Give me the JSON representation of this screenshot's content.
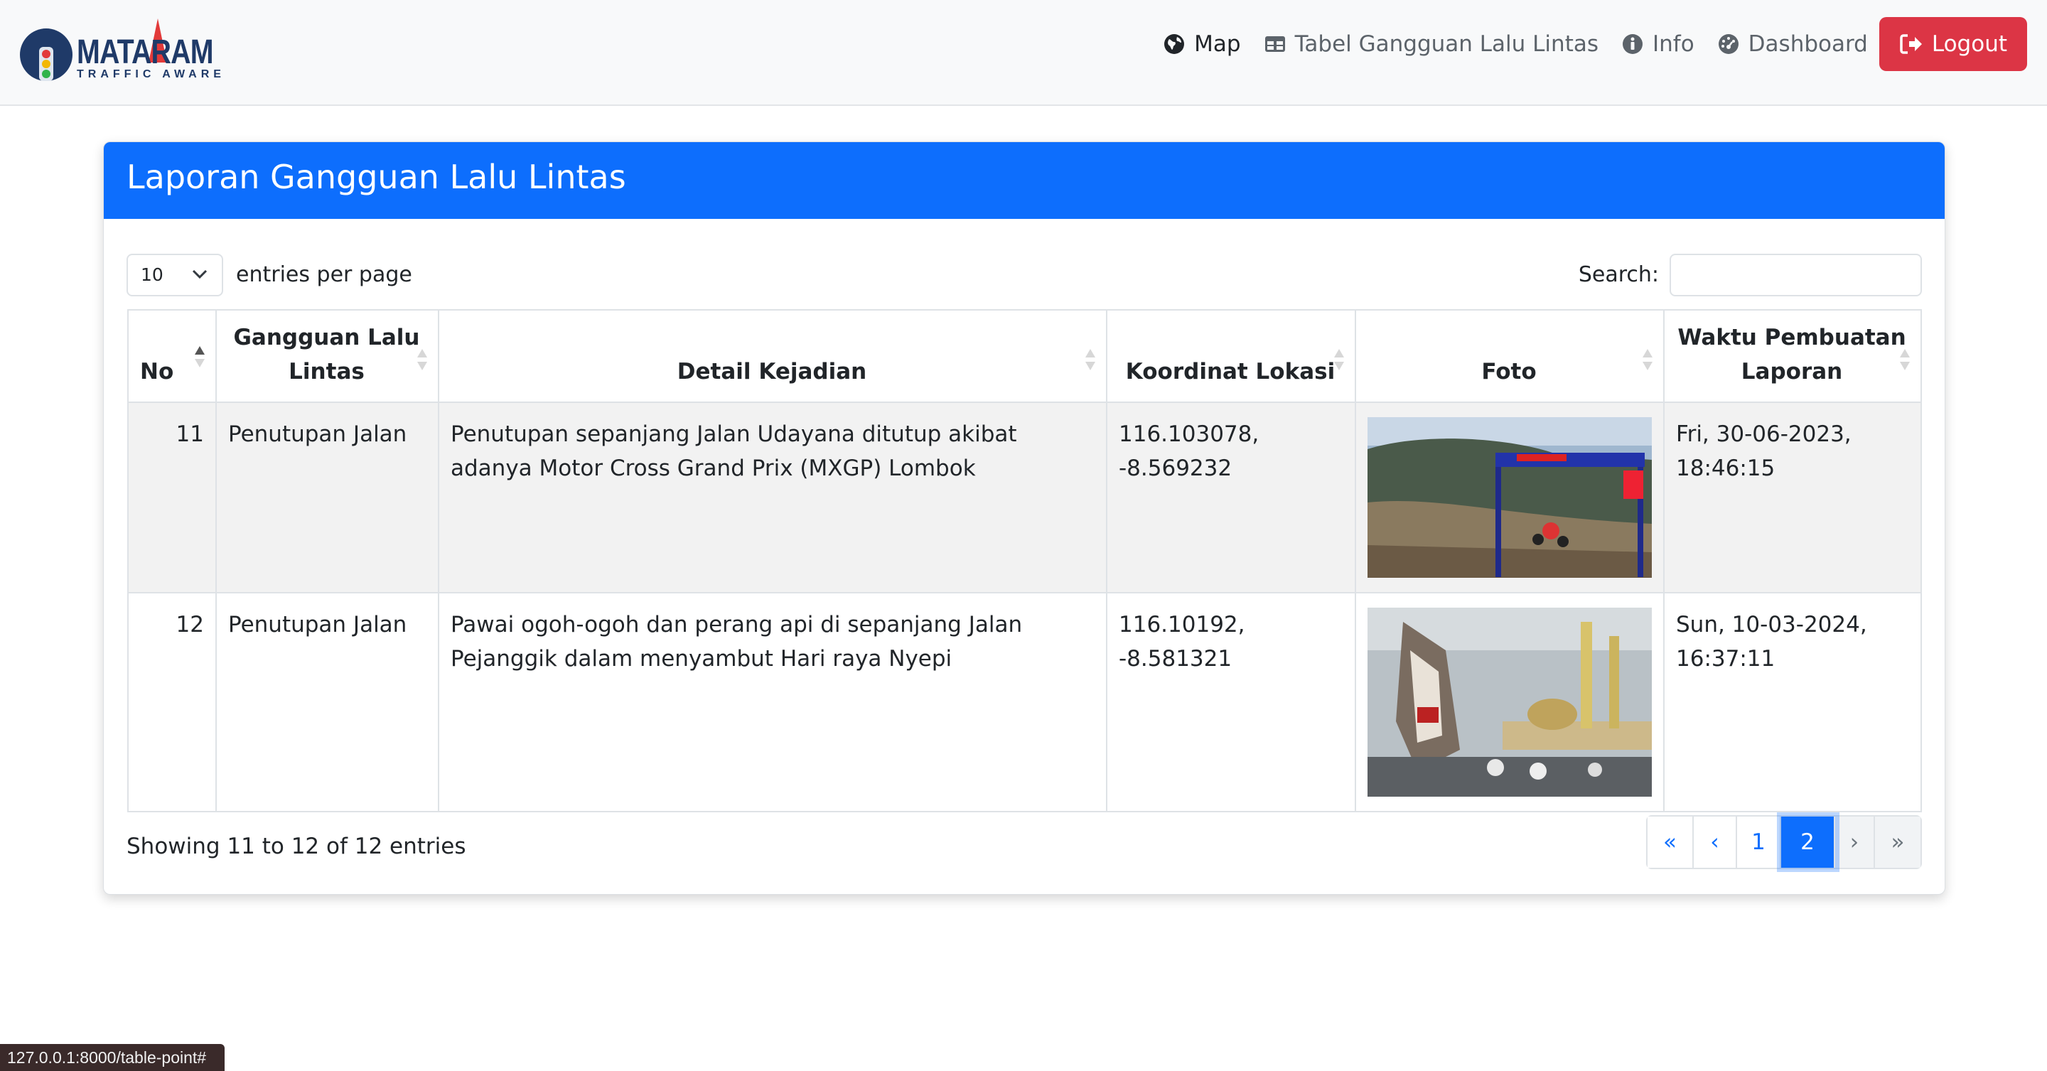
{
  "app": {
    "logo_text": "MATARAM",
    "logo_subtext": "TRAFFIC AWARE"
  },
  "nav": {
    "map": "Map",
    "table": "Tabel Gangguan Lalu Lintas",
    "info": "Info",
    "dashboard": "Dashboard",
    "logout": "Logout"
  },
  "card": {
    "title": "Laporan Gangguan Lalu Lintas"
  },
  "controls": {
    "per_page_value": "10",
    "per_page_label": "entries per page",
    "search_label": "Search:",
    "search_value": ""
  },
  "table": {
    "headers": {
      "no": "No",
      "gangguan": "Gangguan Lalu Lintas",
      "detail": "Detail Kejadian",
      "koordinat": "Koordinat Lokasi",
      "foto": "Foto",
      "waktu": "Waktu Pembuatan Laporan"
    },
    "rows": [
      {
        "no": "11",
        "gangguan": "Penutupan Jalan",
        "detail": "Penutupan sepanjang Jalan Udayana ditutup akibat adanya Motor Cross Grand Prix (MXGP) Lombok",
        "koordinat": "116.103078, -8.569232",
        "waktu": "Fri, 30-06-2023, 18:46:15"
      },
      {
        "no": "12",
        "gangguan": "Penutupan Jalan",
        "detail": "Pawai ogoh-ogoh dan perang api di sepanjang Jalan Pejanggik dalam menyambut Hari raya Nyepi",
        "koordinat": "116.10192, -8.581321",
        "waktu": "Sun, 10-03-2024, 16:37:11"
      }
    ]
  },
  "footer": {
    "info": "Showing 11 to 12 of 12 entries",
    "pages": {
      "first": "«",
      "prev": "‹",
      "p1": "1",
      "p2": "2",
      "next": "›",
      "last": "»"
    }
  },
  "status_url": "127.0.0.1:8000/table-point#",
  "colors": {
    "primary": "#0d6efd",
    "danger": "#dc3545",
    "navbar_bg": "#f8f9fa",
    "stripe": "#f2f2f2"
  },
  "icons": {
    "map": "globe-icon",
    "table": "table-icon",
    "info": "info-circle-icon",
    "dashboard": "dashboard-gauge-icon",
    "logout": "sign-out-icon"
  }
}
